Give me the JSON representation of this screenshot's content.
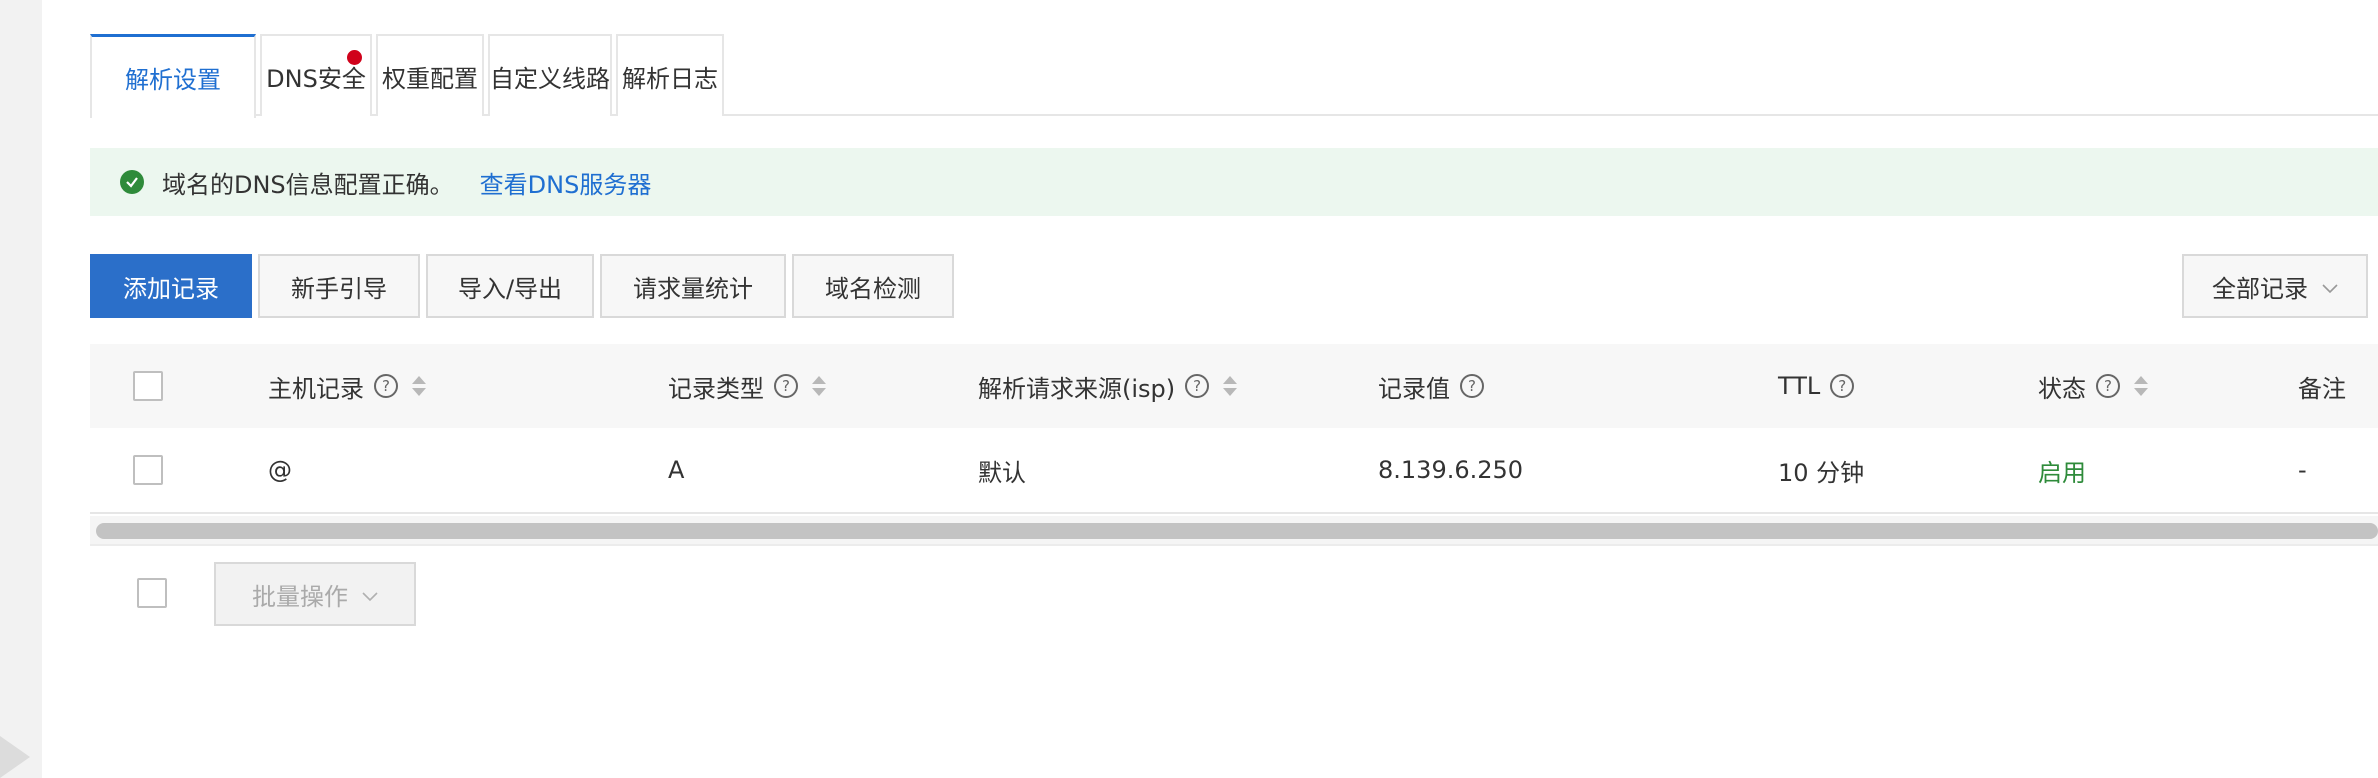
{
  "tabs": [
    {
      "label": "解析设置",
      "active": true
    },
    {
      "label": "DNS安全",
      "badge": true
    },
    {
      "label": "权重配置"
    },
    {
      "label": "自定义线路"
    },
    {
      "label": "解析日志"
    }
  ],
  "alert": {
    "message": "域名的DNS信息配置正确。",
    "link": "查看DNS服务器",
    "icon": "check-circle-icon"
  },
  "toolbar": {
    "add": "添加记录",
    "guide": "新手引导",
    "import_export": "导入/导出",
    "stats": "请求量统计",
    "check": "域名检测",
    "filter": "全部记录"
  },
  "table": {
    "headers": {
      "host": "主机记录",
      "type": "记录类型",
      "isp": "解析请求来源(isp)",
      "value": "记录值",
      "ttl": "TTL",
      "status": "状态",
      "remark": "备注"
    },
    "rows": [
      {
        "host": "@",
        "type": "A",
        "isp": "默认",
        "value": "8.139.6.250",
        "ttl": "10 分钟",
        "status": "启用",
        "remark": "-"
      }
    ]
  },
  "batch": {
    "label": "批量操作"
  },
  "colors": {
    "accent": "#1f6fd1",
    "primary_button": "#2b6fc9",
    "success": "#2e8b3a",
    "alert_bg": "#ecf7ef",
    "badge": "#d0021b"
  }
}
